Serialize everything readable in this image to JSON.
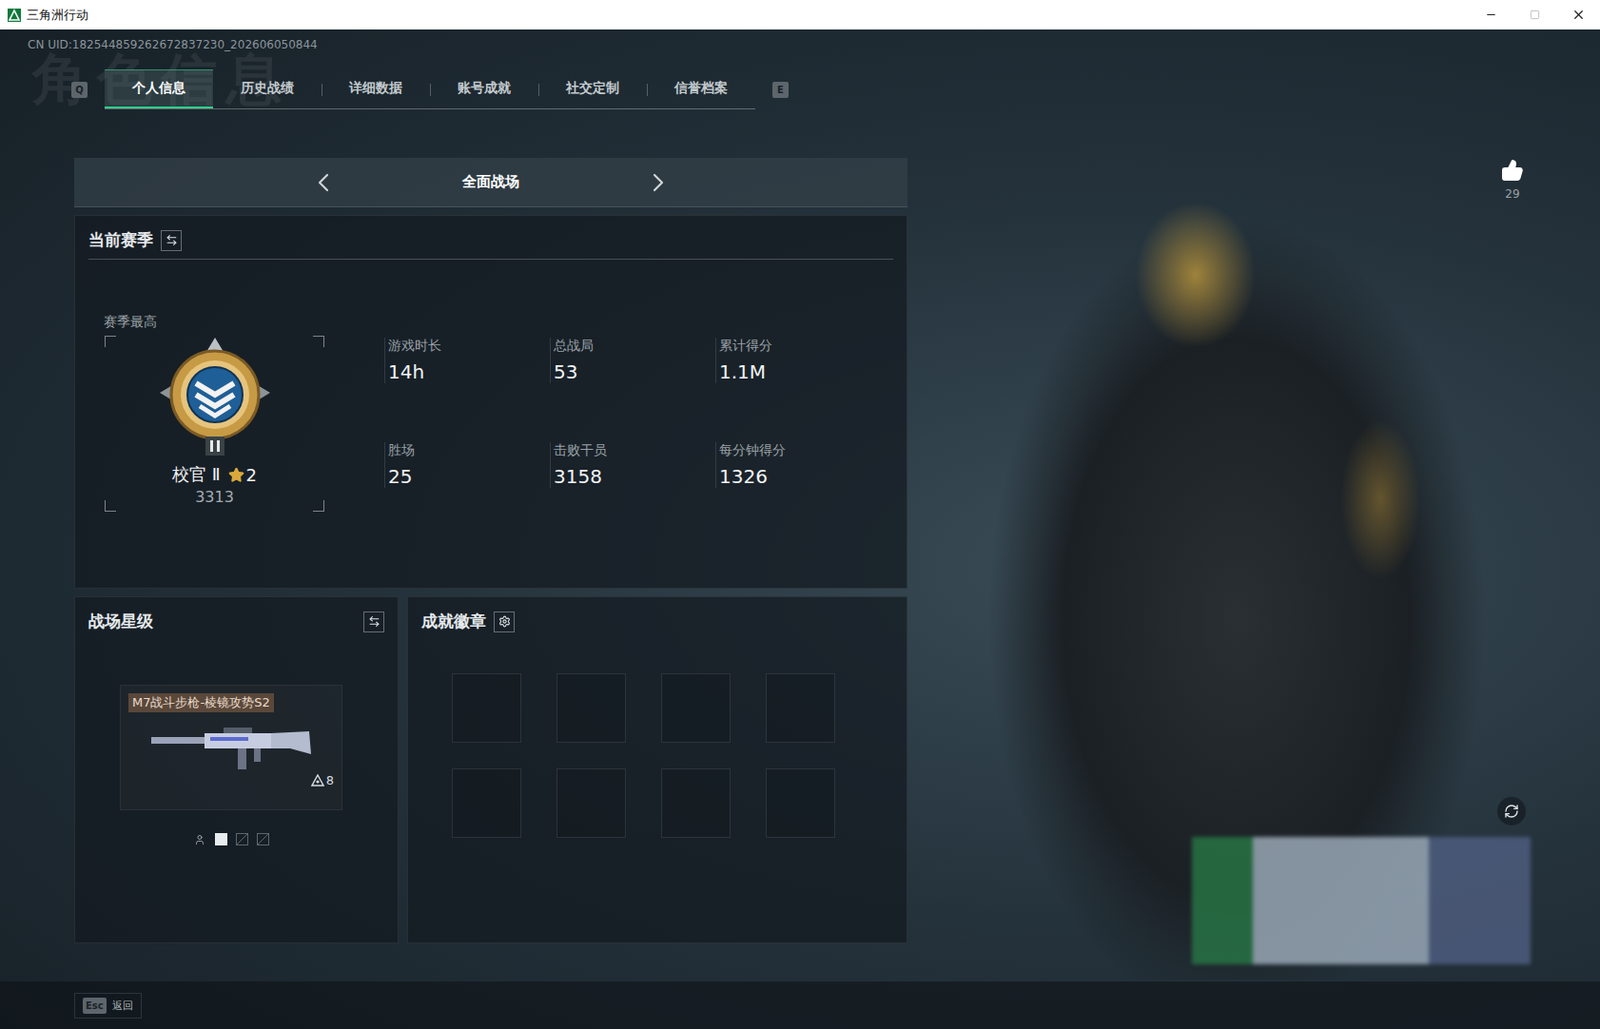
{
  "window": {
    "title": "三角洲行动"
  },
  "uid": "CN UID:182544859262672837230_202606050844",
  "watermark": "角色信息",
  "tab_keys": {
    "prev": "Q",
    "next": "E"
  },
  "tabs": [
    {
      "label": "个人信息",
      "selected": true
    },
    {
      "label": "历史战绩",
      "selected": false
    },
    {
      "label": "详细数据",
      "selected": false
    },
    {
      "label": "账号成就",
      "selected": false
    },
    {
      "label": "社交定制",
      "selected": false
    },
    {
      "label": "信誉档案",
      "selected": false
    }
  ],
  "mode_selector": {
    "label": "全面战场"
  },
  "season": {
    "title": "当前赛季",
    "best_label": "赛季最高",
    "rank": "校官 Ⅱ",
    "star_count": "2",
    "score": "3313",
    "stats": [
      {
        "label": "游戏时长",
        "value": "14h"
      },
      {
        "label": "总战局",
        "value": "53"
      },
      {
        "label": "累计得分",
        "value": "1.1M"
      },
      {
        "label": "胜场",
        "value": "25"
      },
      {
        "label": "击败干员",
        "value": "3158"
      },
      {
        "label": "每分钟得分",
        "value": "1326"
      }
    ]
  },
  "battlefield_level": {
    "title": "战场星级",
    "weapon": {
      "name": "M7战斗步枪-棱镜攻势S2",
      "level": "8"
    },
    "pages": [
      {
        "kind": "icon",
        "selected": false
      },
      {
        "kind": "square",
        "selected": true
      },
      {
        "kind": "slash",
        "selected": false
      },
      {
        "kind": "slash",
        "selected": false
      }
    ]
  },
  "achievements": {
    "title": "成就徽章",
    "slots": [
      {
        "filled": false
      },
      {
        "filled": false
      },
      {
        "filled": false
      },
      {
        "filled": false
      },
      {
        "filled": false
      },
      {
        "filled": false
      },
      {
        "filled": false
      },
      {
        "filled": false
      }
    ]
  },
  "likes": {
    "count": "29"
  },
  "footer": {
    "key": "Esc",
    "label": "返回"
  }
}
